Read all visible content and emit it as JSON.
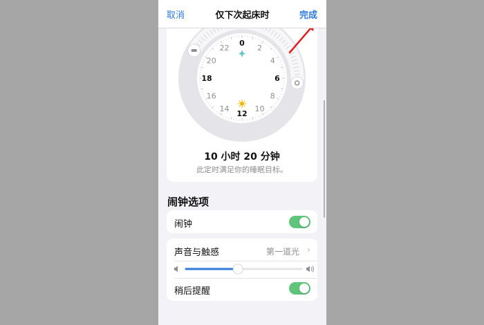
{
  "nav": {
    "cancel_label": "取消",
    "title": "仅下次起床时",
    "done_label": "完成"
  },
  "dial": {
    "hour_labels": [
      "0",
      "2",
      "4",
      "6",
      "8",
      "10",
      "12",
      "14",
      "16",
      "18",
      "20",
      "22"
    ],
    "bedtime_hour": 20.0,
    "wake_hour": 6.33
  },
  "summary": {
    "duration": "10 小时 20 分钟",
    "goal_text": "此定时满足你的睡眠目标。"
  },
  "alarm_options": {
    "section_title": "闹钟选项",
    "alarm_label": "闹钟",
    "alarm_on": true,
    "sound_label": "声音与触感",
    "sound_value": "第一道光",
    "volume_level": 0.45,
    "snooze_label": "稍后提醒",
    "snooze_on": true
  },
  "annotation": {
    "arrow_color": "#e02020"
  },
  "colors": {
    "accent": "#2f7bdc",
    "toggle_on": "#5fc57a",
    "background": "#a6a6a6"
  }
}
